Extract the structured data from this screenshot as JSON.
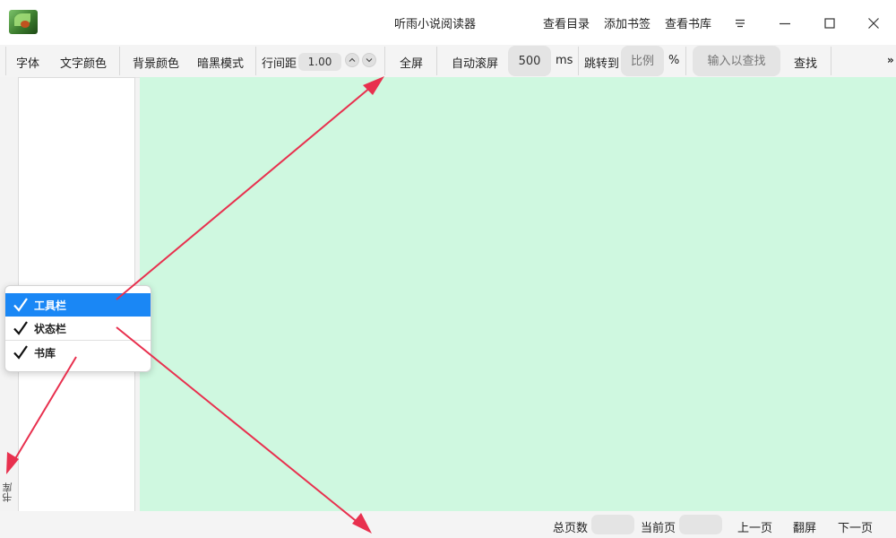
{
  "window": {
    "title": "听雨小说阅读器",
    "nav": {
      "toc": "查看目录",
      "add_bookmark": "添加书签",
      "view_library": "查看书库"
    },
    "icons": {
      "menu": "hamburger-menu-icon",
      "minimize": "minimize-icon",
      "maximize": "maximize-icon",
      "close": "close-icon"
    }
  },
  "toolbar": {
    "font": "字体",
    "text_color": "文字颜色",
    "bg_color": "背景颜色",
    "dark_mode": "暗黑模式",
    "line_spacing_label": "行间距",
    "line_spacing_value": "1.00",
    "fullscreen": "全屏",
    "auto_scroll": "自动滚屏",
    "scroll_interval": "500",
    "scroll_unit": "ms",
    "jump_to": "跳转到",
    "jump_placeholder": "比例",
    "jump_unit": "%",
    "search_placeholder": "输入以查找",
    "search_button": "查找",
    "more": "»"
  },
  "dock": {
    "library_tab": "书库"
  },
  "context_menu": {
    "items": [
      {
        "label": "工具栏",
        "checked": true,
        "highlighted": true
      },
      {
        "label": "状态栏",
        "checked": true,
        "highlighted": false
      },
      {
        "label": "书库",
        "checked": true,
        "highlighted": false
      }
    ]
  },
  "statusbar": {
    "total_pages_label": "总页数",
    "total_pages_value": "",
    "current_page_label": "当前页",
    "current_page_value": "",
    "prev_page": "上一页",
    "flip_screen": "翻屏",
    "next_page": "下一页"
  },
  "colors": {
    "reader_background": "#cff8e0",
    "menu_highlight": "#1a87f5",
    "annotation_arrow": "#e8304e"
  }
}
